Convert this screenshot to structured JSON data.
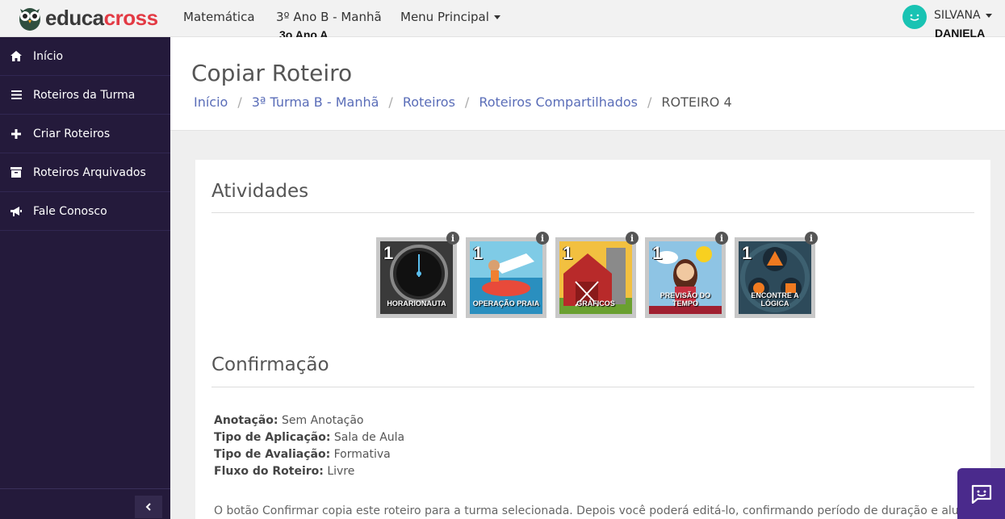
{
  "header": {
    "logo": {
      "part1": "educa",
      "part2": "cross"
    },
    "nav": [
      {
        "label": "Matemática"
      },
      {
        "label": "3º Ano B - Manhã",
        "sublabel": "3o Ano A"
      },
      {
        "label": "Menu Principal"
      }
    ],
    "user": {
      "name": "SILVANA",
      "subname": "DANIELA"
    }
  },
  "sidebar": {
    "items": [
      {
        "label": "Início",
        "icon": "home-icon"
      },
      {
        "label": "Roteiros da Turma",
        "icon": "list-icon"
      },
      {
        "label": "Criar Roteiros",
        "icon": "plus-icon"
      },
      {
        "label": "Roteiros Arquivados",
        "icon": "archive-icon"
      },
      {
        "label": "Fale Conosco",
        "icon": "megaphone-icon"
      }
    ],
    "collapse_icon": "chevron-left-icon"
  },
  "page": {
    "title": "Copiar Roteiro",
    "breadcrumb": [
      "Início",
      "3ª Turma B - Manhã",
      "Roteiros",
      "Roteiros Compartilhados",
      "ROTEIRO 4"
    ]
  },
  "activities": {
    "title": "Atividades",
    "items": [
      {
        "number": "1",
        "label": "HORARIONAUTA",
        "color": "#3b3b3b"
      },
      {
        "number": "1",
        "label": "OPERAÇÃO PRAIA",
        "color": "#4aa9c9"
      },
      {
        "number": "1",
        "label": "GRÁFICOS",
        "color": "#b8322f"
      },
      {
        "number": "1",
        "label": "PREVISÃO DO TEMPO",
        "color": "#7ab3d6"
      },
      {
        "number": "1",
        "label": "ENCONTRE A LÓGICA",
        "color": "#2d4a5a"
      }
    ]
  },
  "confirmation": {
    "title": "Confirmação",
    "fields": [
      {
        "key": "Anotação:",
        "value": "Sem Anotação"
      },
      {
        "key": "Tipo de Aplicação:",
        "value": "Sala de Aula"
      },
      {
        "key": "Tipo de Avaliação:",
        "value": "Formativa"
      },
      {
        "key": "Fluxo do Roteiro:",
        "value": "Livre"
      }
    ],
    "note": "O botão Confirmar copia este roteiro para a turma selecionada. Depois você poderá editá-lo, confirmando período de duração e alunos"
  },
  "chat": {
    "icon": "chat-icon"
  },
  "colors": {
    "sidebar": "#241a3b",
    "accent": "#5a6db8",
    "chat": "#4a2a8c",
    "avatar": "#19c3b3"
  }
}
